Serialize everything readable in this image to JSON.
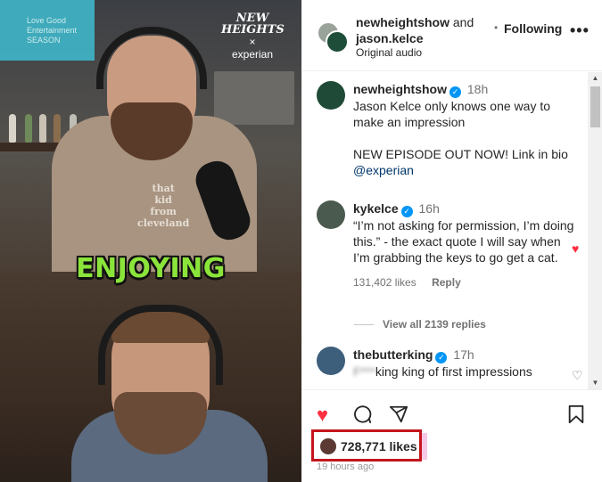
{
  "video": {
    "caption": "ENJOYING",
    "logo": {
      "line1": "NEW",
      "line2": "HEIGHTS",
      "line3": "×",
      "sponsor": "experian"
    },
    "tv_text": "Love Good\nEntertainment\nSEASON",
    "shirt_text": "that\nkid\nfrom\ncleveland"
  },
  "header": {
    "user1": "newheightshow",
    "and": "and",
    "user2": "jason.kelce",
    "audio": "Original audio",
    "dot": "•",
    "follow_label": "Following",
    "more_icon": "more-horizontal-icon"
  },
  "comments": [
    {
      "username": "newheightshow",
      "verified": true,
      "time": "18h",
      "text1": "Jason Kelce only knows one way to make an impression",
      "text2": "NEW EPISODE OUT NOW! Link in bio",
      "mention": "@experian"
    },
    {
      "username": "kykelce",
      "verified": true,
      "time": "16h",
      "text": "“I’m not asking for permission, I’m doing this.” - the exact quote I will say when I’m grabbing the keys to go get a cat.",
      "likes": "131,402 likes",
      "reply": "Reply",
      "liked": true,
      "view_replies": "View all 2139 replies"
    },
    {
      "username": "thebutterking",
      "verified": true,
      "time": "17h",
      "text_blurred": "F***",
      "text": "king king of first impressions"
    }
  ],
  "actions": {
    "like_icon": "heart-filled-icon",
    "comment_icon": "comment-icon",
    "share_icon": "share-icon",
    "save_icon": "bookmark-icon",
    "likes": "728,771 likes",
    "ago": "19 hours ago"
  },
  "colors": {
    "like_red": "#ff3040",
    "verified_blue": "#0095f6",
    "highlight_box": "#c4151c",
    "caption_green": "#8be43a"
  }
}
